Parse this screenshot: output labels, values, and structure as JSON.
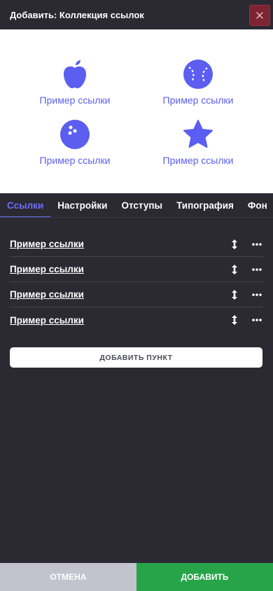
{
  "header": {
    "title": "Добавить: Коллекция ссылок",
    "close_icon": "close-icon"
  },
  "preview": {
    "items": [
      {
        "icon": "apple-icon",
        "label": "Пример ссылки"
      },
      {
        "icon": "baseball-icon",
        "label": "Пример ссылки"
      },
      {
        "icon": "bowling-ball-icon",
        "label": "Пример ссылки"
      },
      {
        "icon": "star-icon",
        "label": "Пример ссылки"
      }
    ],
    "accent_color": "#5b5ef0"
  },
  "tabs": [
    {
      "label": "Ссылки",
      "active": true
    },
    {
      "label": "Настройки",
      "active": false
    },
    {
      "label": "Отступы",
      "active": false
    },
    {
      "label": "Типография",
      "active": false
    },
    {
      "label": "Фон",
      "active": false
    }
  ],
  "list": {
    "items": [
      {
        "label": "Пример ссылки"
      },
      {
        "label": "Пример ссылки"
      },
      {
        "label": "Пример ссылки"
      },
      {
        "label": "Пример ссылки"
      }
    ]
  },
  "actions": {
    "add_item_label": "ДОБАВИТЬ ПУНКТ",
    "cancel_label": "ОТМЕНА",
    "submit_label": "ДОБАВИТЬ"
  },
  "colors": {
    "background": "#2b2a33",
    "active_tab": "#6c6ff5",
    "submit": "#27a448",
    "cancel": "#c2c3cc",
    "close": "#7c2530"
  }
}
